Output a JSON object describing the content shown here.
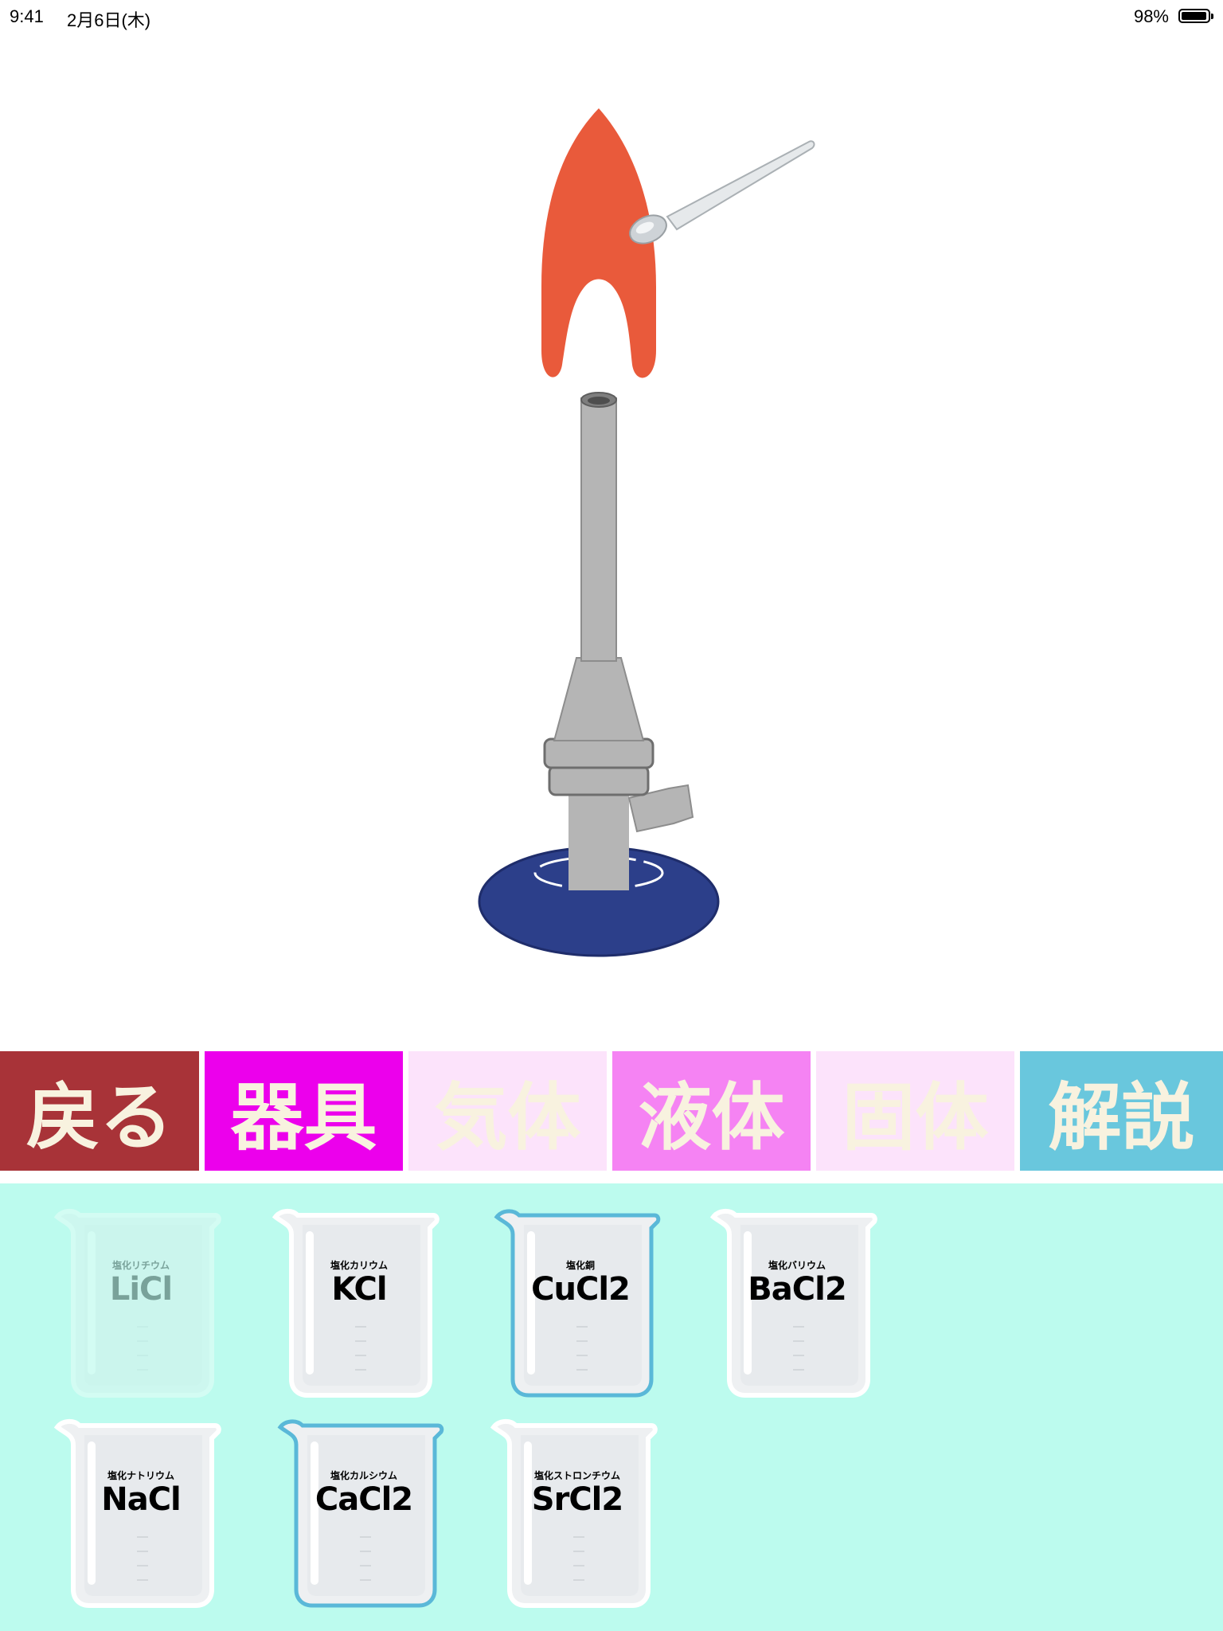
{
  "status_bar": {
    "time": "9:41",
    "date": "2月6日(木)",
    "battery": "98%"
  },
  "scene": {
    "flame_color": "#e95a3b",
    "burner_base_color": "#2c3f8a",
    "burner_body_color": "#b5b5b5",
    "spoon_color": "#d8dcdf"
  },
  "menu": [
    {
      "label": "戻る",
      "bg": "#a83338",
      "color": "#f8f2df"
    },
    {
      "label": "器具",
      "bg": "#ec00ec",
      "color": "#f8f2df"
    },
    {
      "label": "気体",
      "bg": "#fce3fb",
      "color": "#f8f2df"
    },
    {
      "label": "液体",
      "bg": "#f583f3",
      "color": "#f8f2df"
    },
    {
      "label": "固体",
      "bg": "#fce3fb",
      "color": "#f8f2df"
    },
    {
      "label": "解説",
      "bg": "#69c7dd",
      "color": "#f8f2df"
    }
  ],
  "tray": {
    "background": "#bcfbee",
    "beakers": [
      {
        "name": "塩化リチウム",
        "formula": "LiCl",
        "state": "dim",
        "outline": "#ffffff"
      },
      {
        "name": "塩化カリウム",
        "formula": "KCl",
        "state": "normal",
        "outline": "#ffffff"
      },
      {
        "name": "塩化銅",
        "formula": "CuCl2",
        "state": "selected",
        "outline": "#5ab8d8"
      },
      {
        "name": "塩化バリウム",
        "formula": "BaCl2",
        "state": "normal",
        "outline": "#ffffff"
      },
      {
        "name": "塩化ナトリウム",
        "formula": "NaCl",
        "state": "normal",
        "outline": "#ffffff"
      },
      {
        "name": "塩化カルシウム",
        "formula": "CaCl2",
        "state": "selected",
        "outline": "#5ab8d8"
      },
      {
        "name": "塩化ストロンチウム",
        "formula": "SrCl2",
        "state": "normal",
        "outline": "#ffffff"
      }
    ]
  }
}
